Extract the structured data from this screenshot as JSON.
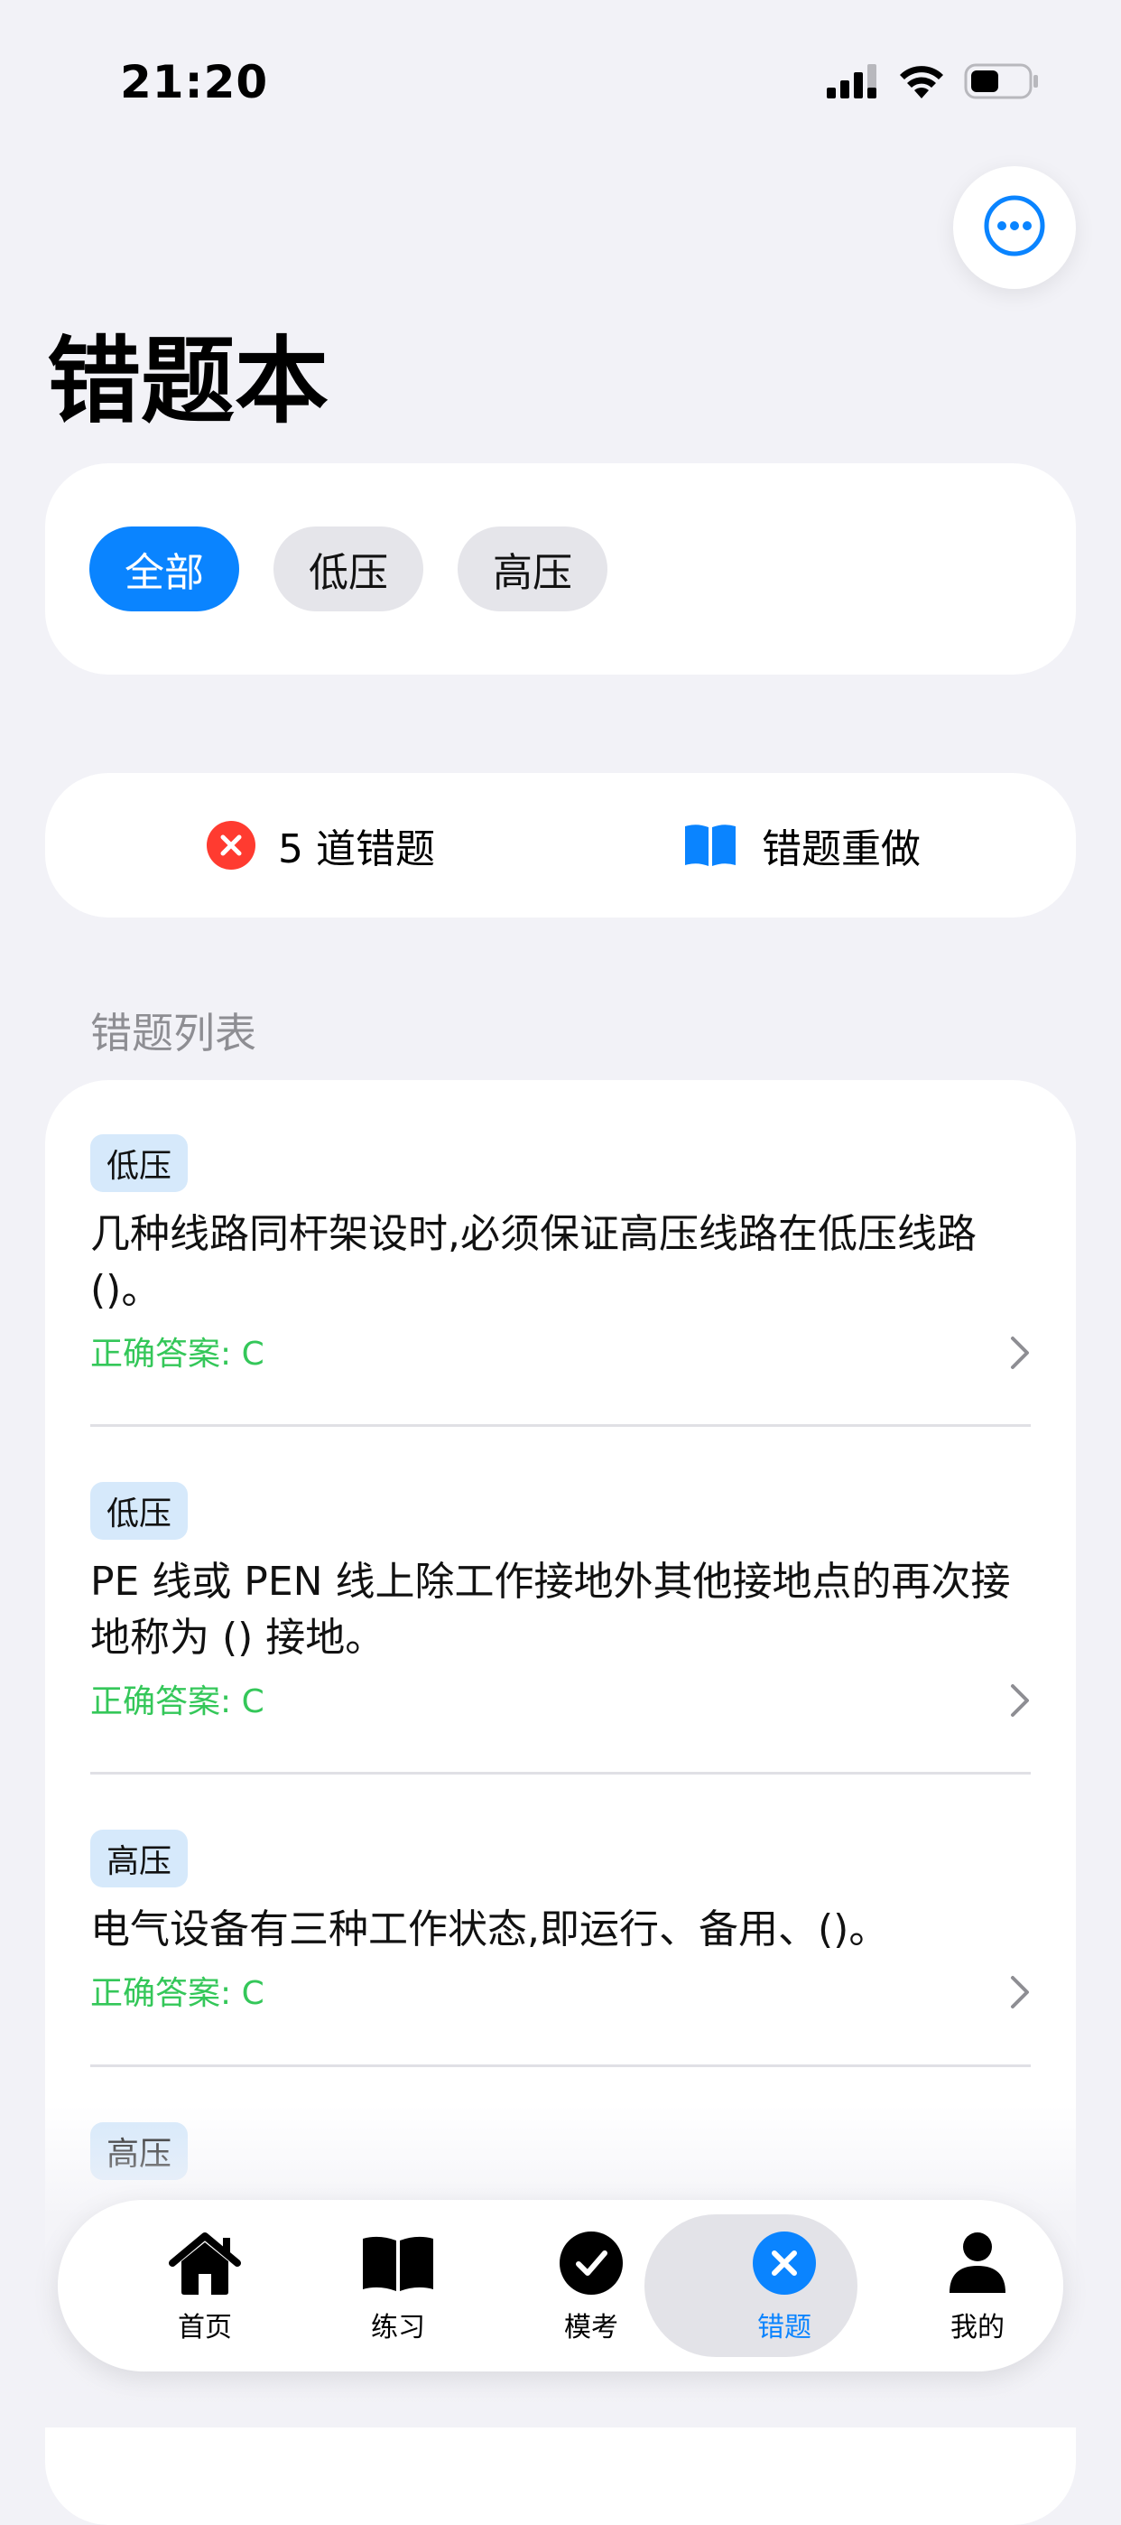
{
  "status_bar": {
    "time": "21:20"
  },
  "header": {
    "title": "错题本"
  },
  "filters": [
    {
      "label": "全部",
      "active": true
    },
    {
      "label": "低压",
      "active": false
    },
    {
      "label": "高压",
      "active": false
    }
  ],
  "summary": {
    "count_label": "5 道错题",
    "redo_label": "错题重做"
  },
  "list": {
    "section_label": "错题列表",
    "items": [
      {
        "tag": "低压",
        "question": "几种线路同杆架设时,必须保证高压线路在低压线路 ()。",
        "answer": "正确答案: C"
      },
      {
        "tag": "低压",
        "question": "PE 线或 PEN 线上除工作接地外其他接地点的再次接地称为 () 接地。",
        "answer": "正确答案: C"
      },
      {
        "tag": "高压",
        "question": "电气设备有三种工作状态,即运行、备用、()。",
        "answer": "正确答案: C"
      },
      {
        "tag": "高压"
      }
    ]
  },
  "tabs": [
    {
      "label": "首页",
      "icon": "house-icon"
    },
    {
      "label": "练习",
      "icon": "book-icon"
    },
    {
      "label": "模考",
      "icon": "checkmark-circle-icon"
    },
    {
      "label": "错题",
      "icon": "x-circle-icon",
      "active": true
    },
    {
      "label": "我的",
      "icon": "person-icon"
    }
  ],
  "colors": {
    "accent": "#0a84ff",
    "error": "#ff3b30",
    "correct": "#34c759",
    "tag_bg": "#d6e9fb"
  }
}
